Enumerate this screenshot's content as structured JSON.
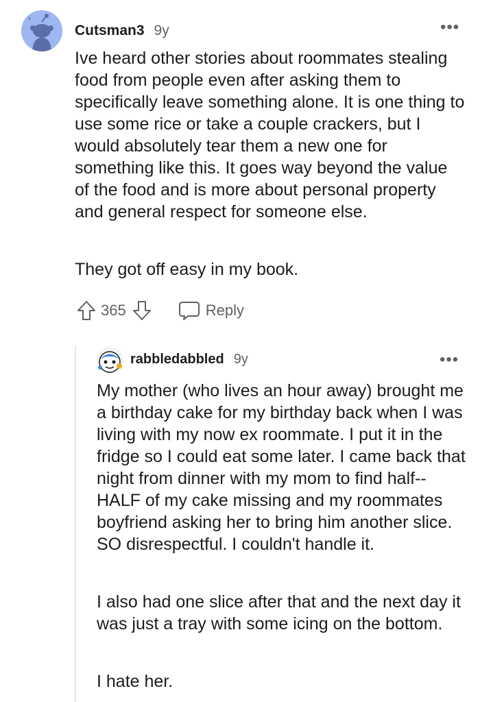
{
  "comments": [
    {
      "username": "Cutsman3",
      "age": "9y",
      "avatar_icon": "snoo-avatar-icon",
      "paragraphs": [
        "Ive heard other stories about roommates stealing food from people even after asking them to specifically leave something alone. It is one thing to use some rice or take a couple crackers, but I would absolutely tear them a new one for something like this. It goes way beyond the value of the food and is more about personal property and general respect for someone else.",
        "They got off easy in my book."
      ],
      "score": "365",
      "reply_label": "Reply",
      "more_label": "•••"
    },
    {
      "username": "rabbledabbled",
      "age": "9y",
      "avatar_icon": "snoo-avatar-icon",
      "paragraphs": [
        "My mother (who lives an hour away) brought me a birthday cake for my birthday back when I was living with my now ex roommate. I put it in the fridge so I could eat some later. I came back that night from dinner with my mom to find half--HALF of my cake missing and my roommates boyfriend asking her to bring him another slice. SO disrespectful. I couldn't handle it.",
        "I also had one slice after that and the next day it was just a tray with some icing on the bottom.",
        "I hate her."
      ],
      "more_label": "•••"
    }
  ],
  "icons": {
    "upvote": "upvote-arrow-icon",
    "downvote": "downvote-arrow-icon",
    "reply": "speech-bubble-icon",
    "more": "more-options-icon"
  },
  "colors": {
    "text": "#1c1c1c",
    "muted": "#5d6266",
    "avatar_main_bg": "#9eb7f2",
    "thread_line": "#e4e6e8"
  }
}
